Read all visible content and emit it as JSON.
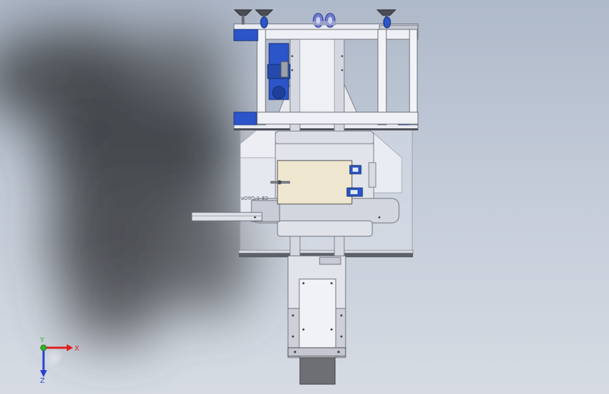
{
  "viewport": {
    "background_top": "#aeb9c9",
    "background_bottom": "#d6dbe3"
  },
  "model": {
    "label_text": "ᴚO9O-1-ƎƆ",
    "colors": {
      "frame": "#e8ebf2",
      "blue_parts": "#2b55c8",
      "bracket_beige": "#efe6cf",
      "steel": "#c9ccd6",
      "dark_block": "#6e6f74"
    }
  },
  "triad": {
    "x_label": "X",
    "y_label": "Y",
    "z_label": "Z",
    "x_color": "#e02020",
    "y_color": "#2cb52c",
    "z_color": "#2a3fd0"
  }
}
